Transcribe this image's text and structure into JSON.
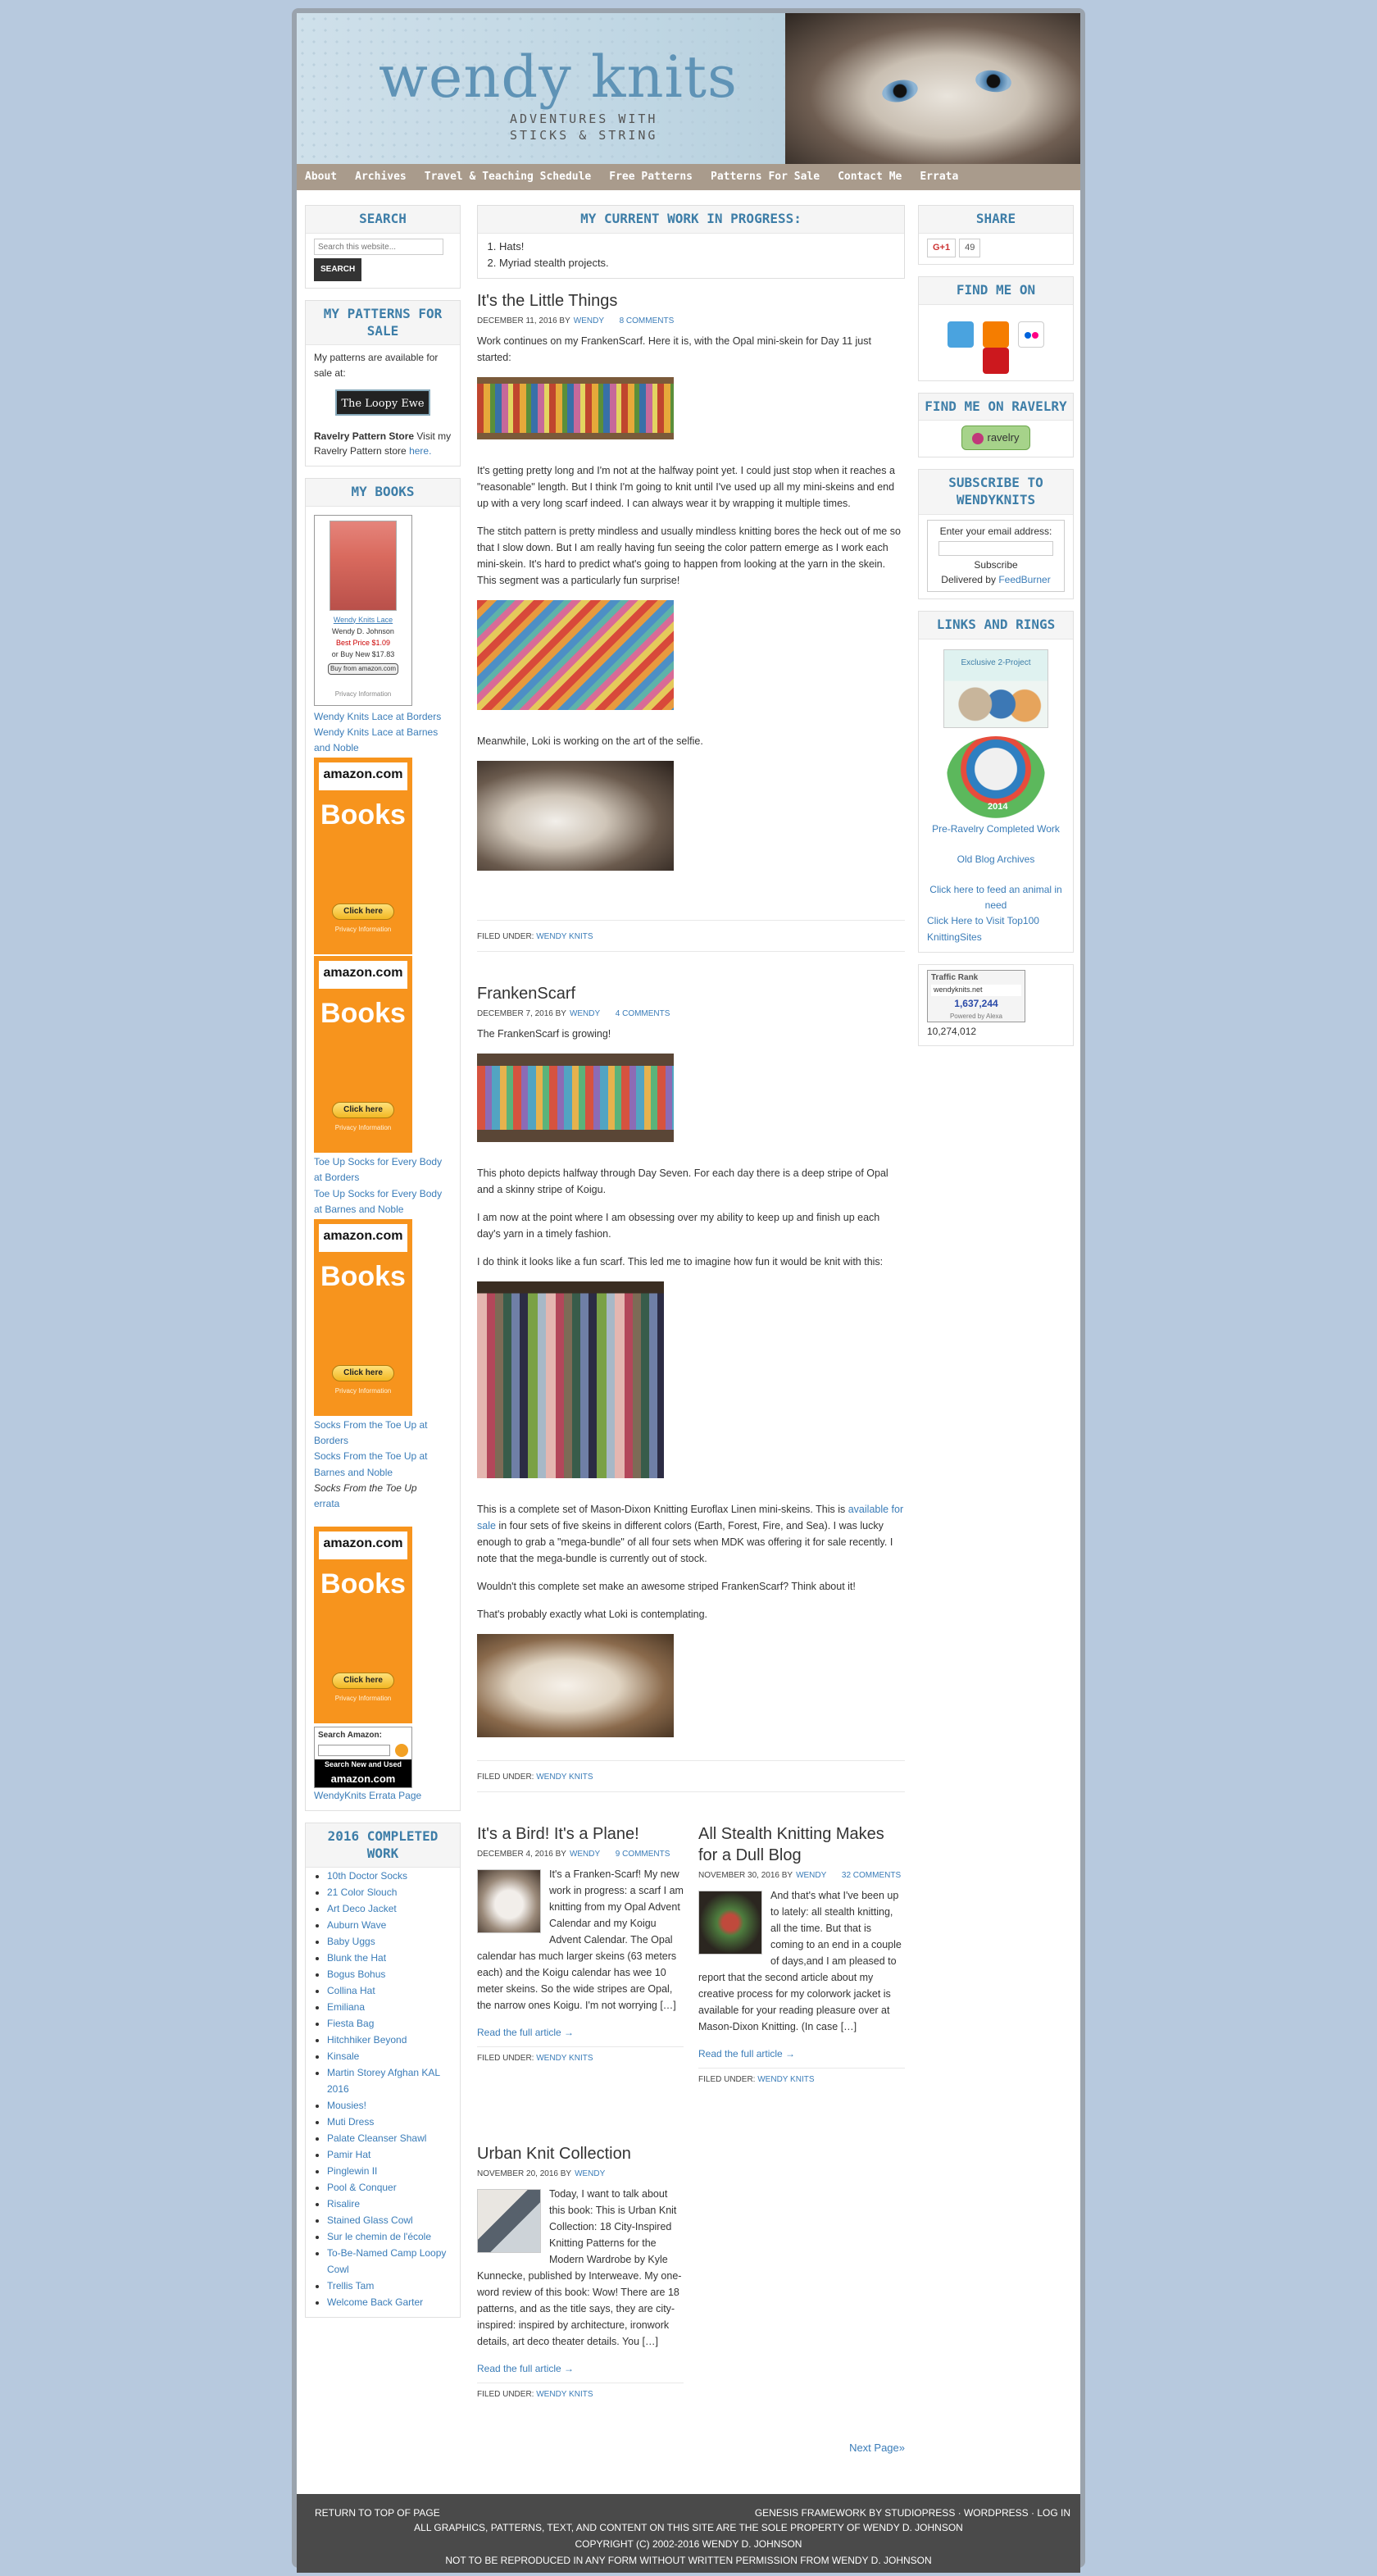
{
  "header": {
    "title": "wendy knits",
    "tagline_1": "ADVENTURES WITH",
    "tagline_2": "STICKS & STRING"
  },
  "nav": [
    "About",
    "Archives",
    "Travel & Teaching Schedule",
    "Free Patterns",
    "Patterns For Sale",
    "Contact Me",
    "Errata"
  ],
  "left": {
    "search": {
      "title": "SEARCH",
      "placeholder": "Search this website...",
      "button": "SEARCH"
    },
    "patterns": {
      "title": "MY PATTERNS FOR SALE",
      "text": "My patterns are available for sale at:",
      "loopy": "The Loopy Ewe",
      "ravelry_store_bold": "Ravelry Pattern Store",
      "ravelry_store_text": " Visit my Ravelry Pattern store",
      "here": "here."
    },
    "books": {
      "title": "MY BOOKS",
      "book_link": "Wendy Knits Lace",
      "author": "Wendy D. Johnson",
      "best_price": "Best Price $1.09",
      "buy_new": "or Buy New $17.83",
      "buy_btn": "Buy from amazon.com",
      "privacy": "Privacy Information",
      "links1": [
        "Wendy Knits Lace at Borders",
        "Wendy Knits Lace at Barnes and Noble"
      ],
      "links2": [
        "Toe Up Socks for Every Body at Borders",
        "Toe Up Socks for Every Body at Barnes and Noble"
      ],
      "links3": [
        "Socks From the Toe Up at Borders",
        "Socks From the Toe Up at Barnes and Noble"
      ],
      "errata_italic": "Socks From the Toe Up",
      "errata_link": "errata",
      "ad_logo": "amazon.com",
      "ad_books": "Books",
      "ad_click": "Click here",
      "ad_privacy": "Privacy Information",
      "search_amazon": "Search Amazon:",
      "search_amazon_sub1": "Search New and Used",
      "search_amazon_sub2": "amazon.com",
      "errata_page": "WendyKnits Errata Page"
    },
    "completed": {
      "title": "2016 COMPLETED WORK",
      "items": [
        "10th Doctor Socks",
        "21 Color Slouch",
        "Art Deco Jacket",
        "Auburn Wave",
        "Baby Uggs",
        "Blunk the Hat",
        "Bogus Bohus",
        "Collina Hat",
        "Emiliana",
        "Fiesta Bag",
        "Hitchhiker Beyond",
        "Kinsale",
        "Martin Storey Afghan KAL 2016",
        "Mousies!",
        "Muti Dress",
        "Palate Cleanser Shawl",
        "Pamir Hat",
        "Pinglewin II",
        "Pool & Conquer",
        "Risalire",
        "Stained Glass Cowl",
        "Sur le chemin de l'école",
        "To-Be-Named Camp Loopy Cowl",
        "Trellis Tam",
        "Welcome Back Garter"
      ]
    }
  },
  "main": {
    "wip": {
      "title": "MY CURRENT WORK IN PROGRESS:",
      "items": [
        "Hats!",
        "Myriad stealth projects."
      ]
    },
    "post1": {
      "title": "It's the Little Things",
      "date": "DECEMBER 11, 2016 BY",
      "author": "WENDY",
      "comments": "8 COMMENTS",
      "p1": "Work continues on my FrankenScarf. Here it is, with the Opal mini-skein for Day 11 just started:",
      "p2": "It's getting pretty long and I'm not at the halfway point yet. I could just stop when it reaches a \"reasonable\" length. But I think I'm going to knit until I've used up all my mini-skeins and end up with a very long scarf indeed. I can always wear it by wrapping it multiple times.",
      "p3": "The stitch pattern is pretty mindless and usually mindless knitting bores the heck out of me so that I slow down. But I am really having fun seeing the color pattern emerge as I work each mini-skein. It's hard to predict what's going to happen from looking at the yarn in the skein. This segment was a particularly fun surprise!",
      "p4": "Meanwhile, Loki is working on the art of the selfie.",
      "filed": "FILED UNDER:",
      "category": "WENDY KNITS"
    },
    "post2": {
      "title": "FrankenScarf",
      "date": "DECEMBER 7, 2016 BY",
      "author": "WENDY",
      "comments": "4 COMMENTS",
      "p1": "The FrankenScarf is growing!",
      "p2": "This photo depicts halfway through Day Seven. For each day there is a deep stripe of Opal and a skinny stripe of Koigu.",
      "p3": "I am now at the point where I am obsessing over my ability to keep up and finish up each day's yarn in a timely fashion.",
      "p4": "I do think it looks like a fun scarf. This led me to imagine how fun it would be knit with this:",
      "p5a": "This is a complete set of Mason-Dixon Knitting Euroflax Linen mini-skeins. This is ",
      "p5link": "available for sale",
      "p5b": " in four sets of five skeins in different colors (Earth, Forest, Fire, and Sea). I was lucky enough to grab a \"mega-bundle\" of all four sets when MDK was offering it for sale recently. I note that the mega-bundle is currently out of stock.",
      "p6": "Wouldn't this complete set make an awesome striped FrankenScarf? Think about it!",
      "p7": "That's probably exactly what Loki is contemplating.",
      "filed": "FILED UNDER:",
      "category": "WENDY KNITS"
    },
    "post3": {
      "title": "It's a Bird! It's a Plane!",
      "date": "DECEMBER 4, 2016 BY",
      "author": "WENDY",
      "comments": "9 COMMENTS",
      "excerpt": "It's a Franken-Scarf! My new work in progress: a scarf I am knitting from my Opal Advent Calendar and my Koigu Advent Calendar. The Opal calendar has much larger skeins (63 meters each) and the Koigu calendar has wee 10 meter skeins. So the wide stripes are Opal, the narrow ones Koigu. I'm not worrying […]",
      "more": "Read the full article →",
      "filed": "FILED UNDER:",
      "category": "WENDY KNITS"
    },
    "post4": {
      "title": "All Stealth Knitting Makes for a Dull Blog",
      "date": "NOVEMBER 30, 2016 BY",
      "author": "WENDY",
      "comments": "32 COMMENTS",
      "excerpt": "And that's what I've been up to lately: all stealth knitting, all the time. But that is coming to an end in a couple of days,and I am pleased to report that the second article about my creative process for my colorwork jacket is available for your reading pleasure over at Mason-Dixon Knitting. (In case […]",
      "more": "Read the full article →",
      "filed": "FILED UNDER:",
      "category": "WENDY KNITS"
    },
    "post5": {
      "title": "Urban Knit Collection",
      "date": "NOVEMBER 20, 2016 BY",
      "author": "WENDY",
      "excerpt": "Today, I want to talk about this book: This is Urban Knit Collection: 18 City-Inspired Knitting Patterns for the Modern Wardrobe by Kyle Kunnecke, published by Interweave. My one-word review of this book: Wow! There are 18 patterns, and as the title says, they are city-inspired: inspired by architecture, ironwork details, art deco theater details. You […]",
      "more": "Read the full article →",
      "filed": "FILED UNDER:",
      "category": "WENDY KNITS"
    },
    "next": "Next Page»"
  },
  "right": {
    "share": {
      "title": "SHARE",
      "gplus": "G+1",
      "count": "49"
    },
    "findme": {
      "title": "FIND ME ON",
      "icons": [
        "twitter-icon",
        "blogger-icon",
        "flickr-icon",
        "youtube-icon"
      ]
    },
    "ravelry": {
      "title": "FIND ME ON RAVELRY",
      "badge": "ravelry"
    },
    "subscribe": {
      "title": "SUBSCRIBE TO WENDYKNITS",
      "label": "Enter your email address:",
      "button": "Subscribe",
      "delivered": "Delivered by",
      "feedburner": "FeedBurner"
    },
    "links": {
      "title": "LINKS AND RINGS",
      "banner1": "Exclusive 2-Project",
      "banner2": "2014",
      "items": [
        "Pre-Ravelry Completed Work",
        "Old Blog Archives",
        "Click here to feed an animal in need",
        "Click Here to Visit Top100 KnittingSites"
      ]
    },
    "traffic": {
      "title": "Traffic Rank",
      "site": "wendyknits.net",
      "rank": "1,637,244",
      "powered": "Powered by Alexa",
      "count": "10,274,012"
    }
  },
  "footer": {
    "top": "RETURN TO TOP OF PAGE",
    "right": "GENESIS FRAMEWORK BY STUDIOPRESS · WORDPRESS · LOG IN",
    "line1": "ALL GRAPHICS, PATTERNS, TEXT, AND CONTENT ON THIS SITE ARE THE SOLE PROPERTY OF WENDY D. JOHNSON",
    "line2": "COPYRIGHT (C) 2002-2016 WENDY D. JOHNSON",
    "line3": "NOT TO BE REPRODUCED IN ANY FORM WITHOUT WRITTEN PERMISSION FROM WENDY D. JOHNSON"
  }
}
